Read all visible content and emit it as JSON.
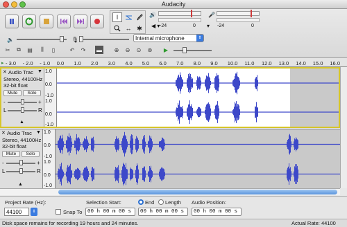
{
  "window": {
    "title": "Audacity"
  },
  "toolbar": {
    "device": "Internal microphone",
    "meter_ticks": [
      "-24",
      "0",
      "-24",
      "0"
    ]
  },
  "ruler": {
    "ticks": [
      "- 3.0",
      "- 2.0",
      "- 1.0",
      "0.0",
      "1.0",
      "2.0",
      "3.0",
      "4.0",
      "5.0",
      "6.0",
      "7.0",
      "8.0",
      "9.0",
      "10.0",
      "11.0",
      "12.0",
      "13.0",
      "14.0",
      "15.0",
      "16.0"
    ]
  },
  "tracks": [
    {
      "name": "Audio Trac",
      "info1": "Stereo, 44100Hz",
      "info2": "32-bit float",
      "mute": "Mute",
      "solo": "Solo",
      "lr_left": "L",
      "lr_right": "R",
      "scale": [
        "1.0",
        "0.0",
        "-1.0",
        "1.0",
        "0.0",
        "-1.0"
      ],
      "minus": "-",
      "plus": "+"
    },
    {
      "name": "Audio Trac",
      "info1": "Stereo, 44100Hz",
      "info2": "32-bit float",
      "mute": "Mute",
      "solo": "Solo",
      "lr_left": "L",
      "lr_right": "R",
      "scale": [
        "1.0",
        "0.0",
        "-1.0",
        "1.0",
        "0.0",
        "-1.0"
      ],
      "minus": "-",
      "plus": "+"
    }
  ],
  "selection_bar": {
    "project_rate_label": "Project Rate (Hz):",
    "project_rate_value": "44100",
    "snap_to_label": "Snap To",
    "selection_start_label": "Selection Start:",
    "end_label": "End",
    "length_label": "Length",
    "audio_position_label": "Audio Position:",
    "time1": "00 h 00 m 00 s",
    "time2": "00 h 00 m 00 s",
    "time3": "00 h 00 m 00 s"
  },
  "status": {
    "left": "Disk space remains for recording 19 hours and 24 minutes.",
    "right": "Actual Rate: 44100"
  },
  "colors": {
    "waveform": "#3d48c9",
    "selection_outline": "#d6c52a"
  }
}
